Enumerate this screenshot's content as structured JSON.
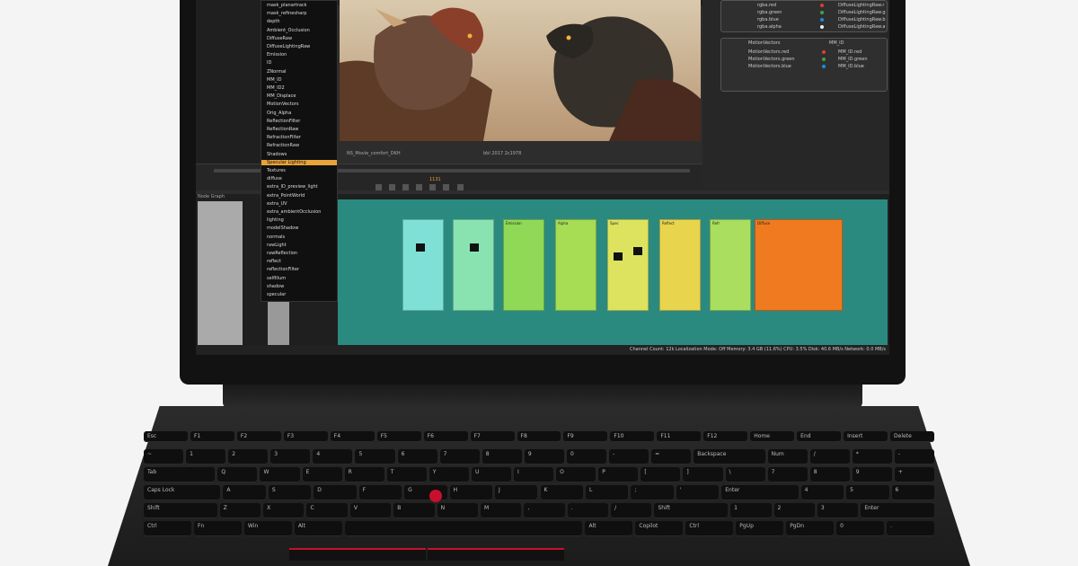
{
  "menu": {
    "items": [
      "mask_planartrack",
      "mask_refinesharp",
      "depth",
      "Ambient_Occlusion",
      "DiffuseRaw",
      "DiffuseLightingRaw",
      "Emission",
      "ID",
      "ZNormal",
      "MM_ID",
      "MM_ID2",
      "MM_Displace",
      "MotionVectors",
      "Orig_Alpha",
      "ReflectionFilter",
      "ReflectionRaw",
      "RefractionFilter",
      "RefractionRaw",
      "Shadows",
      "Specular Lighting",
      "Textures",
      "diffuse",
      "extra_ID_preview_light",
      "extra_PointWorld",
      "extra_UV",
      "extra_ambientOcclusion",
      "lighting",
      "modelShadow",
      "normals",
      "rawLight",
      "rawReflection",
      "reflect",
      "reflectionFilter",
      "selfIllum",
      "shadow",
      "specular"
    ],
    "selected_index": 19
  },
  "viewer": {
    "caption_left": "NS_Movie_comfort_DKH",
    "caption_mid": "bbl 2017 2c1978"
  },
  "timeline": {
    "frame": "1131"
  },
  "right_panel": {
    "rows_top": [
      "rgba.red",
      "rgba.green",
      "rgba.blue",
      "rgba.alpha"
    ],
    "rows_top_right": [
      "DiffuseLightingRaw.r",
      "DiffuseLightingRaw.g",
      "DiffuseLightingRaw.b",
      "DiffuseLightingRaw.a"
    ],
    "node_a": "MotionVectors",
    "node_b": "MM_ID",
    "rows_bottom": [
      "MotionVectors.red",
      "MotionVectors.green",
      "MotionVectors.blue"
    ],
    "rows_bottom_right": [
      "MM_ID.red",
      "MM_ID.green",
      "MM_ID.blue"
    ],
    "dot_colors": [
      "#e53935",
      "#43a047",
      "#1e88e5",
      "#eeeeee"
    ]
  },
  "node_graph": {
    "label": "Node Graph",
    "blocks": [
      {
        "color": "#7fe0d8",
        "label": ""
      },
      {
        "color": "#88e3b0",
        "label": ""
      },
      {
        "color": "#8fd957",
        "label": "Emission"
      },
      {
        "color": "#a7dc55",
        "label": "Alpha"
      },
      {
        "color": "#dde35e",
        "label": "Spec"
      },
      {
        "color": "#e8d54d",
        "label": "Reflect"
      },
      {
        "color": "#a9de5f",
        "label": "Refr"
      },
      {
        "color": "#f07a1f",
        "label": "Diffuse"
      }
    ]
  },
  "status_bar": {
    "text": "Channel Count: 12k  Localization Mode: Off  Memory: 3.4 GB (11.6%)  CPU: 3.5%  Disk: 40.6 MB/s  Network: 0.0 MB/s"
  },
  "keyboard": {
    "rows": [
      [
        "Esc",
        "F1",
        "F2",
        "F3",
        "F4",
        "F5",
        "F6",
        "F7",
        "F8",
        "F9",
        "F10",
        "F11",
        "F12",
        "Home",
        "End",
        "Insert",
        "Delete"
      ],
      [
        "~",
        "1",
        "2",
        "3",
        "4",
        "5",
        "6",
        "7",
        "8",
        "9",
        "0",
        "-",
        "=",
        "Backspace",
        "Num",
        "/",
        "*",
        "-"
      ],
      [
        "Tab",
        "Q",
        "W",
        "E",
        "R",
        "T",
        "Y",
        "U",
        "I",
        "O",
        "P",
        "[",
        "]",
        "\\",
        "7",
        "8",
        "9",
        "+"
      ],
      [
        "Caps Lock",
        "A",
        "S",
        "D",
        "F",
        "G",
        "H",
        "J",
        "K",
        "L",
        ";",
        "'",
        "Enter",
        "4",
        "5",
        "6"
      ],
      [
        "Shift",
        "Z",
        "X",
        "C",
        "V",
        "B",
        "N",
        "M",
        ",",
        ".",
        "/",
        "Shift",
        "1",
        "2",
        "3",
        "Enter"
      ],
      [
        "Ctrl",
        "Fn",
        "Win",
        "Alt",
        "",
        "Alt",
        "Copilot",
        "Ctrl",
        "PgUp",
        "PgDn",
        "0",
        "."
      ]
    ]
  }
}
